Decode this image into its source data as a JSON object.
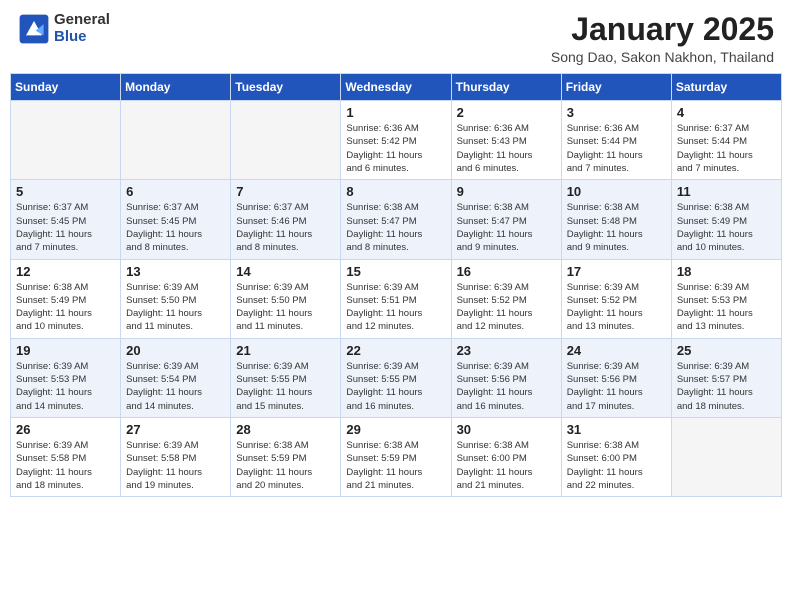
{
  "header": {
    "logo_general": "General",
    "logo_blue": "Blue",
    "month_title": "January 2025",
    "subtitle": "Song Dao, Sakon Nakhon, Thailand"
  },
  "weekdays": [
    "Sunday",
    "Monday",
    "Tuesday",
    "Wednesday",
    "Thursday",
    "Friday",
    "Saturday"
  ],
  "weeks": [
    [
      {
        "day": "",
        "info": ""
      },
      {
        "day": "",
        "info": ""
      },
      {
        "day": "",
        "info": ""
      },
      {
        "day": "1",
        "info": "Sunrise: 6:36 AM\nSunset: 5:42 PM\nDaylight: 11 hours\nand 6 minutes."
      },
      {
        "day": "2",
        "info": "Sunrise: 6:36 AM\nSunset: 5:43 PM\nDaylight: 11 hours\nand 6 minutes."
      },
      {
        "day": "3",
        "info": "Sunrise: 6:36 AM\nSunset: 5:44 PM\nDaylight: 11 hours\nand 7 minutes."
      },
      {
        "day": "4",
        "info": "Sunrise: 6:37 AM\nSunset: 5:44 PM\nDaylight: 11 hours\nand 7 minutes."
      }
    ],
    [
      {
        "day": "5",
        "info": "Sunrise: 6:37 AM\nSunset: 5:45 PM\nDaylight: 11 hours\nand 7 minutes."
      },
      {
        "day": "6",
        "info": "Sunrise: 6:37 AM\nSunset: 5:45 PM\nDaylight: 11 hours\nand 8 minutes."
      },
      {
        "day": "7",
        "info": "Sunrise: 6:37 AM\nSunset: 5:46 PM\nDaylight: 11 hours\nand 8 minutes."
      },
      {
        "day": "8",
        "info": "Sunrise: 6:38 AM\nSunset: 5:47 PM\nDaylight: 11 hours\nand 8 minutes."
      },
      {
        "day": "9",
        "info": "Sunrise: 6:38 AM\nSunset: 5:47 PM\nDaylight: 11 hours\nand 9 minutes."
      },
      {
        "day": "10",
        "info": "Sunrise: 6:38 AM\nSunset: 5:48 PM\nDaylight: 11 hours\nand 9 minutes."
      },
      {
        "day": "11",
        "info": "Sunrise: 6:38 AM\nSunset: 5:49 PM\nDaylight: 11 hours\nand 10 minutes."
      }
    ],
    [
      {
        "day": "12",
        "info": "Sunrise: 6:38 AM\nSunset: 5:49 PM\nDaylight: 11 hours\nand 10 minutes."
      },
      {
        "day": "13",
        "info": "Sunrise: 6:39 AM\nSunset: 5:50 PM\nDaylight: 11 hours\nand 11 minutes."
      },
      {
        "day": "14",
        "info": "Sunrise: 6:39 AM\nSunset: 5:50 PM\nDaylight: 11 hours\nand 11 minutes."
      },
      {
        "day": "15",
        "info": "Sunrise: 6:39 AM\nSunset: 5:51 PM\nDaylight: 11 hours\nand 12 minutes."
      },
      {
        "day": "16",
        "info": "Sunrise: 6:39 AM\nSunset: 5:52 PM\nDaylight: 11 hours\nand 12 minutes."
      },
      {
        "day": "17",
        "info": "Sunrise: 6:39 AM\nSunset: 5:52 PM\nDaylight: 11 hours\nand 13 minutes."
      },
      {
        "day": "18",
        "info": "Sunrise: 6:39 AM\nSunset: 5:53 PM\nDaylight: 11 hours\nand 13 minutes."
      }
    ],
    [
      {
        "day": "19",
        "info": "Sunrise: 6:39 AM\nSunset: 5:53 PM\nDaylight: 11 hours\nand 14 minutes."
      },
      {
        "day": "20",
        "info": "Sunrise: 6:39 AM\nSunset: 5:54 PM\nDaylight: 11 hours\nand 14 minutes."
      },
      {
        "day": "21",
        "info": "Sunrise: 6:39 AM\nSunset: 5:55 PM\nDaylight: 11 hours\nand 15 minutes."
      },
      {
        "day": "22",
        "info": "Sunrise: 6:39 AM\nSunset: 5:55 PM\nDaylight: 11 hours\nand 16 minutes."
      },
      {
        "day": "23",
        "info": "Sunrise: 6:39 AM\nSunset: 5:56 PM\nDaylight: 11 hours\nand 16 minutes."
      },
      {
        "day": "24",
        "info": "Sunrise: 6:39 AM\nSunset: 5:56 PM\nDaylight: 11 hours\nand 17 minutes."
      },
      {
        "day": "25",
        "info": "Sunrise: 6:39 AM\nSunset: 5:57 PM\nDaylight: 11 hours\nand 18 minutes."
      }
    ],
    [
      {
        "day": "26",
        "info": "Sunrise: 6:39 AM\nSunset: 5:58 PM\nDaylight: 11 hours\nand 18 minutes."
      },
      {
        "day": "27",
        "info": "Sunrise: 6:39 AM\nSunset: 5:58 PM\nDaylight: 11 hours\nand 19 minutes."
      },
      {
        "day": "28",
        "info": "Sunrise: 6:38 AM\nSunset: 5:59 PM\nDaylight: 11 hours\nand 20 minutes."
      },
      {
        "day": "29",
        "info": "Sunrise: 6:38 AM\nSunset: 5:59 PM\nDaylight: 11 hours\nand 21 minutes."
      },
      {
        "day": "30",
        "info": "Sunrise: 6:38 AM\nSunset: 6:00 PM\nDaylight: 11 hours\nand 21 minutes."
      },
      {
        "day": "31",
        "info": "Sunrise: 6:38 AM\nSunset: 6:00 PM\nDaylight: 11 hours\nand 22 minutes."
      },
      {
        "day": "",
        "info": ""
      }
    ]
  ]
}
